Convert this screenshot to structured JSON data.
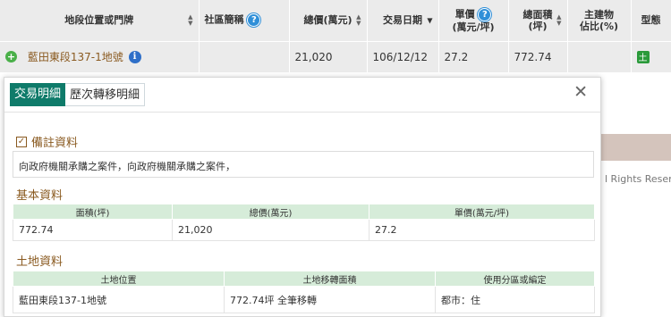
{
  "table": {
    "headers": {
      "location": "地段位置或門牌",
      "community": "社區簡稱",
      "total_price": "總價(萬元)",
      "date": "交易日期",
      "unit_price_line1": "單價",
      "unit_price_line2": "(萬元/坪)",
      "area_line1": "總面積",
      "area_line2": "(坪)",
      "building_ratio_line1": "主建物",
      "building_ratio_line2": "佔比(%)",
      "type": "型態"
    },
    "row": {
      "location": "藍田東段137-1地號",
      "community": "",
      "total_price": "21,020",
      "date": "106/12/12",
      "unit_price": "27.2",
      "area": "772.74",
      "building_ratio": "",
      "type_badge": "土"
    }
  },
  "background": {
    "footer_text": "l Rights Reserv"
  },
  "popup": {
    "tabs": [
      "交易明細",
      "歷次轉移明細"
    ],
    "close": "✕",
    "remarks": {
      "title": "備註資料",
      "text": "向政府機關承購之案件，向政府機關承購之案件，"
    },
    "basic": {
      "title": "基本資料",
      "headers": [
        "面積(坪)",
        "總價(萬元)",
        "單價(萬元/坪)"
      ],
      "values": [
        "772.74",
        "21,020",
        "27.2"
      ]
    },
    "land": {
      "title": "土地資料",
      "headers": [
        "土地位置",
        "土地移轉面積",
        "使用分區或編定"
      ],
      "values": [
        "藍田東段137-1地號",
        "772.74坪 全筆移轉",
        "都市：住"
      ]
    }
  },
  "icons": {
    "help": "question-circle-icon",
    "info": "info-circle-icon",
    "expand": "plus-circle-icon",
    "check": "checkbox-checked-icon",
    "sort": "sort-icon"
  },
  "colors": {
    "accent_tab": "#0f7b6a",
    "section_title": "#8a5a20",
    "table_header_green": "#d6ecd9",
    "help_blue": "#2f8fd8",
    "plus_green": "#4ab049"
  }
}
